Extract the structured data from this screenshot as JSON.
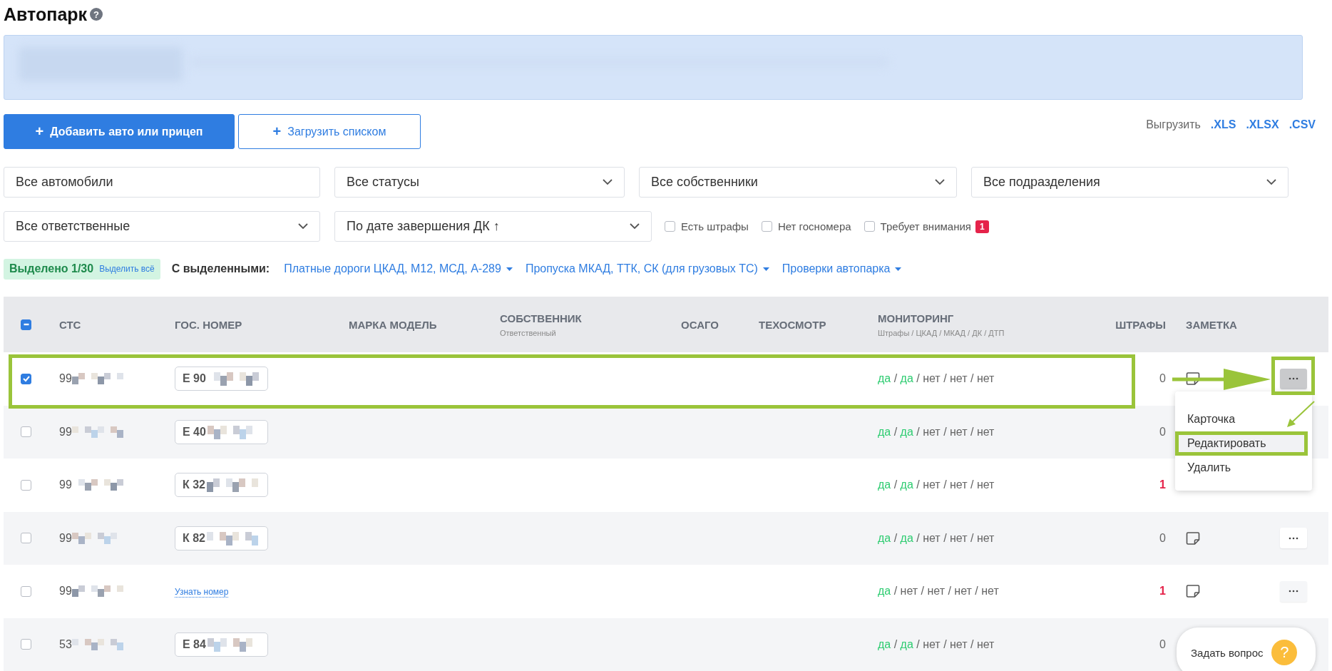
{
  "page": {
    "title": "Автопарк",
    "help_icon": "?"
  },
  "toolbar": {
    "add_button": {
      "icon": "+",
      "label": "Добавить авто или прицеп"
    },
    "upload_button": {
      "icon": "+",
      "label": "Загрузить списком"
    },
    "export": {
      "label": "Выгрузить",
      "formats": [
        ".XLS",
        ".XLSX",
        ".CSV"
      ]
    }
  },
  "filters": {
    "search": {
      "value": "Все автомобили"
    },
    "dropdowns": [
      {
        "value": "Все статусы"
      },
      {
        "value": "Все собственники"
      },
      {
        "value": "Все подразделения"
      },
      {
        "value": "Все ответственные"
      },
      {
        "value": "По дате завершения ДК ↑"
      }
    ],
    "checkboxes": [
      {
        "label": "Есть штрафы",
        "checked": false
      },
      {
        "label": "Нет госномера",
        "checked": false
      },
      {
        "label": "Требует внимания",
        "checked": false,
        "badge": "1"
      }
    ]
  },
  "selection": {
    "count": "Выделено 1/30",
    "select_all": "Выделить всё",
    "with_selected": "С выделенными:",
    "actions": [
      "Платные дороги ЦКАД, М12, МСД, А-289",
      "Пропуска МКАД, ТТК, СК (для грузовых ТС)",
      "Проверки автопарка"
    ]
  },
  "table": {
    "header_checkbox": {
      "indeterminate": true
    },
    "columns": [
      {
        "title": "СТС"
      },
      {
        "title": "ГОС. НОМЕР"
      },
      {
        "title": "МАРКА МОДЕЛЬ"
      },
      {
        "title": "СОБСТВЕННИК",
        "subtitle": "Ответственный"
      },
      {
        "title": "ОСАГО"
      },
      {
        "title": "ТЕХОСМОТР"
      },
      {
        "title": "МОНИТОРИНГ",
        "subtitle": "Штрафы / ЦКАД / МКАД / ДК / ДТП"
      },
      {
        "title": "ШТРАФЫ"
      },
      {
        "title": "ЗАМЕТКА"
      }
    ],
    "separator": "/",
    "rows": [
      {
        "selected": true,
        "sts": "99",
        "plate": {
          "kind": "plate",
          "text": "Е 90"
        },
        "monitoring": [
          {
            "text": "да",
            "ok": true
          },
          {
            "text": "да",
            "ok": true
          },
          {
            "text": "нет",
            "ok": false
          },
          {
            "text": "нет",
            "ok": false
          },
          {
            "text": "нет",
            "ok": false
          }
        ],
        "fines": {
          "text": "0",
          "alert": false
        },
        "menu_open": true,
        "covered": false
      },
      {
        "selected": false,
        "sts": "99",
        "plate": {
          "kind": "plate",
          "text": "Е 40"
        },
        "monitoring": [
          {
            "text": "да",
            "ok": true
          },
          {
            "text": "да",
            "ok": true
          },
          {
            "text": "нет",
            "ok": false
          },
          {
            "text": "нет",
            "ok": false
          },
          {
            "text": "нет",
            "ok": false
          }
        ],
        "fines": {
          "text": "0",
          "alert": false
        },
        "covered": true
      },
      {
        "selected": false,
        "sts": "99",
        "plate": {
          "kind": "plate",
          "text": "К 32"
        },
        "monitoring": [
          {
            "text": "да",
            "ok": true
          },
          {
            "text": "да",
            "ok": true
          },
          {
            "text": "нет",
            "ok": false
          },
          {
            "text": "нет",
            "ok": false
          },
          {
            "text": "нет",
            "ok": false
          }
        ],
        "fines": {
          "text": "1",
          "alert": true
        },
        "covered": true
      },
      {
        "selected": false,
        "sts": "99",
        "plate": {
          "kind": "plate",
          "text": "К 82"
        },
        "monitoring": [
          {
            "text": "да",
            "ok": true
          },
          {
            "text": "да",
            "ok": true
          },
          {
            "text": "нет",
            "ok": false
          },
          {
            "text": "нет",
            "ok": false
          },
          {
            "text": "нет",
            "ok": false
          }
        ],
        "fines": {
          "text": "0",
          "alert": false
        },
        "menu_open": false,
        "covered": false
      },
      {
        "selected": false,
        "sts": "99",
        "plate": {
          "kind": "link",
          "text": "Узнать номер"
        },
        "monitoring": [
          {
            "text": "да",
            "ok": true
          },
          {
            "text": "нет",
            "ok": false
          },
          {
            "text": "нет",
            "ok": false
          },
          {
            "text": "нет",
            "ok": false
          },
          {
            "text": "нет",
            "ok": false
          }
        ],
        "fines": {
          "text": "1",
          "alert": true
        },
        "menu_open": false,
        "covered": false
      },
      {
        "selected": false,
        "sts": "53",
        "plate": {
          "kind": "plate",
          "text": "Е 84"
        },
        "monitoring": [
          {
            "text": "да",
            "ok": true
          },
          {
            "text": "да",
            "ok": true
          },
          {
            "text": "нет",
            "ok": false
          },
          {
            "text": "нет",
            "ok": false
          },
          {
            "text": "нет",
            "ok": false
          }
        ],
        "fines": {
          "text": "0",
          "alert": false
        },
        "covered": true
      }
    ]
  },
  "row_menu": {
    "items": [
      {
        "label": "Карточка",
        "highlighted": false
      },
      {
        "label": "Редактировать",
        "highlighted": true
      },
      {
        "label": "Удалить",
        "highlighted": false
      }
    ]
  },
  "chat_widget": {
    "label": "Задать вопрос",
    "icon": "?"
  }
}
